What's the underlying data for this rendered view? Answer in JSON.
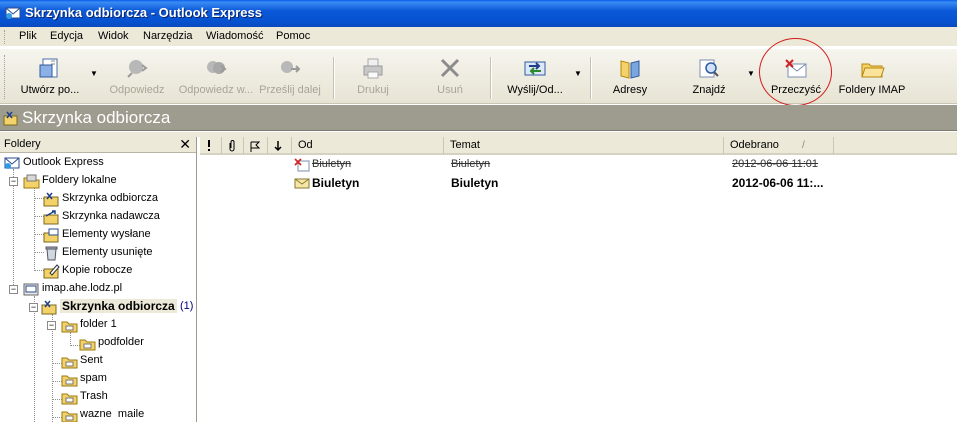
{
  "window": {
    "title": "Skrzynka odbiorcza - Outlook Express"
  },
  "menu": [
    "Plik",
    "Edycja",
    "Widok",
    "Narzędzia",
    "Wiadomość",
    "Pomoc"
  ],
  "toolbar": {
    "create": "Utwórz po...",
    "reply": "Odpowiedz",
    "reply_all": "Odpowiedz w...",
    "forward": "Prześlij dalej",
    "print": "Drukuj",
    "delete": "Usuń",
    "send_receive": "Wyślij/Od...",
    "addresses": "Adresy",
    "find": "Znajdź",
    "purge": "Przeczyść",
    "imap_folders": "Foldery IMAP"
  },
  "infobar": {
    "title": "Skrzynka odbiorcza"
  },
  "folders": {
    "header": "Foldery",
    "close": "✕",
    "items": [
      {
        "label": "Outlook Express"
      },
      {
        "label": "Foldery lokalne"
      },
      {
        "label": "Skrzynka odbiorcza"
      },
      {
        "label": "Skrzynka nadawcza"
      },
      {
        "label": "Elementy wysłane"
      },
      {
        "label": "Elementy usunięte"
      },
      {
        "label": "Kopie robocze"
      },
      {
        "label": "imap.ahe.lodz.pl"
      },
      {
        "label": "Skrzynka odbiorcza",
        "count": "(1)"
      },
      {
        "label": "folder 1"
      },
      {
        "label": "podfolder"
      },
      {
        "label": "Sent"
      },
      {
        "label": "spam"
      },
      {
        "label": "Trash"
      },
      {
        "label": "wazne  maile"
      }
    ]
  },
  "columns": {
    "from": "Od",
    "subject": "Temat",
    "received": "Odebrano",
    "sort": "/"
  },
  "messages": [
    {
      "from": "Biuletyn",
      "subject": "Biuletyn",
      "received": "2012-06-06 11:01",
      "state": "deleted"
    },
    {
      "from": "Biuletyn",
      "subject": "Biuletyn",
      "received": "2012-06-06 11:...",
      "state": "unread"
    }
  ],
  "colors": {
    "titlebar": "#0a58d8",
    "chrome": "#ece9d8",
    "infobar": "#9e9b8f",
    "annotation": "#d21a1a"
  }
}
